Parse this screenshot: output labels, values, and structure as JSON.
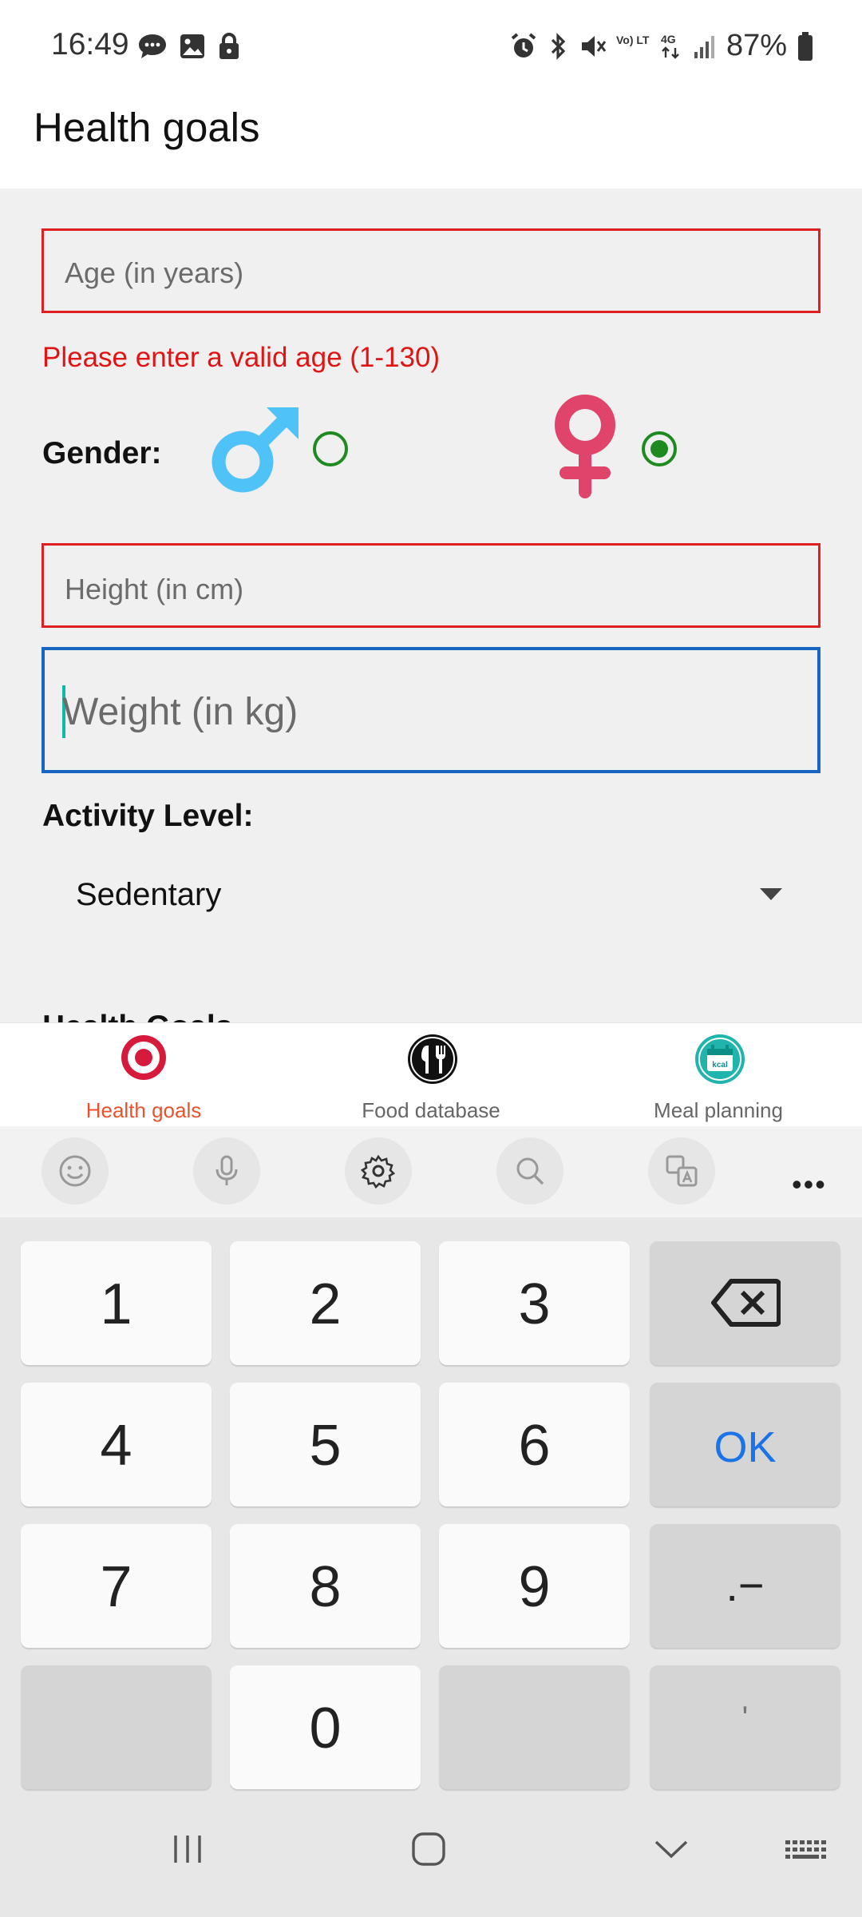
{
  "status_bar": {
    "time": "16:49",
    "left_icons": [
      "message-icon",
      "image-icon",
      "lock-icon"
    ],
    "right_icons": [
      "alarm-icon",
      "bluetooth-icon",
      "mute-icon",
      "volte-icon",
      "4g-icon",
      "signal-icon",
      "battery-icon"
    ],
    "volte_text": "Vo) LTE1",
    "network_text": "4G",
    "battery_text": "87%"
  },
  "header": {
    "title": "Health goals"
  },
  "form": {
    "age_placeholder": "Age (in years)",
    "age_error": "Please enter a valid age (1-130)",
    "gender_label": "Gender:",
    "gender_options": [
      {
        "name": "male",
        "selected": false
      },
      {
        "name": "female",
        "selected": true
      }
    ],
    "height_placeholder": "Height (in cm)",
    "weight_placeholder": "Weight (in kg)",
    "activity_label": "Activity Level:",
    "activity_value": "Sedentary",
    "health_goals_heading": "Health Goals"
  },
  "bottom_nav": {
    "items": [
      {
        "label": "Health goals",
        "icon": "target-icon",
        "active": true
      },
      {
        "label": "Food database",
        "icon": "cutlery-icon",
        "active": false
      },
      {
        "label": "Meal planning",
        "icon": "calendar-kcal-icon",
        "active": false
      }
    ],
    "kcal_text": "kcal"
  },
  "keyboard": {
    "toolbar": [
      "emoji-icon",
      "microphone-icon",
      "settings-icon",
      "search-icon",
      "translate-icon",
      "more-icon"
    ],
    "more_text": "•••",
    "keys": {
      "k1": "1",
      "k2": "2",
      "k3": "3",
      "k4": "4",
      "k5": "5",
      "k6": "6",
      "k7": "7",
      "k8": "8",
      "k9": "9",
      "k0": "0",
      "ok": "OK",
      "dot": ".−",
      "apostrophe": "'"
    }
  },
  "colors": {
    "error_red": "#e01414",
    "focus_blue": "#1565c0",
    "radio_green": "#1f8a1f",
    "active_nav": "#e8532e",
    "male_blue": "#4fc3f7",
    "female_pink": "#e0446a"
  }
}
